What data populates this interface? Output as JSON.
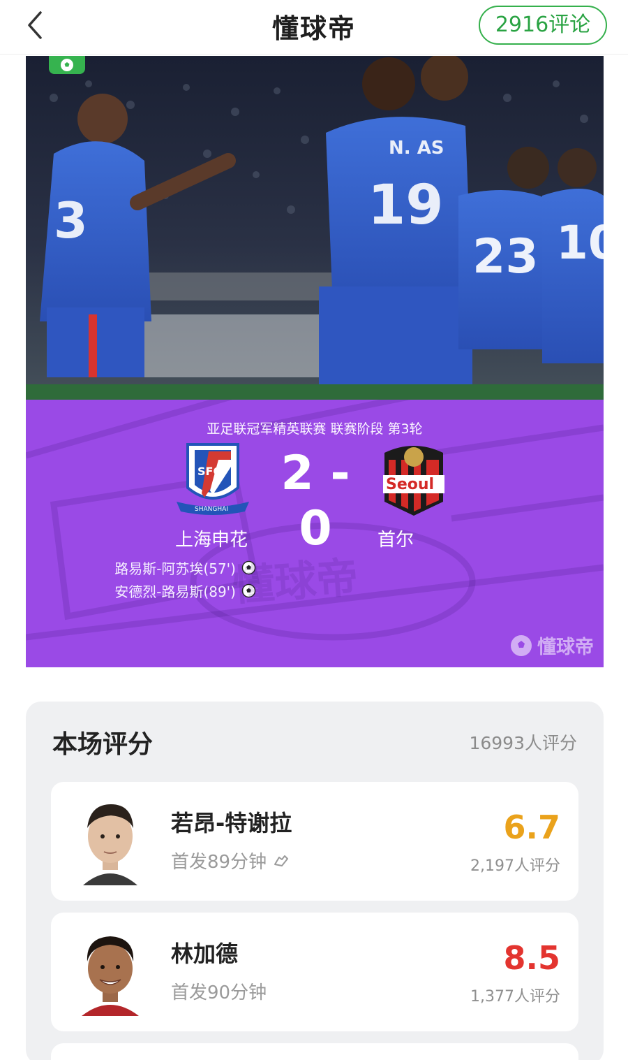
{
  "header": {
    "title": "懂球帝",
    "comments_label": "2916评论"
  },
  "match": {
    "competition": "亚足联冠军精英联赛 联赛阶段 第3轮",
    "score": "2 - 0",
    "home_team": "上海申花",
    "away_team": "首尔",
    "home_logo_text": "SFC",
    "home_logo_ribbon": "SHANGHAI",
    "away_logo_text": "Seoul",
    "scorers": [
      {
        "text": "路易斯-阿苏埃(57')",
        "icon": "soccer-ball-icon"
      },
      {
        "text": "安德烈-路易斯(89')",
        "icon": "soccer-ball-icon"
      }
    ],
    "watermark": "懂球帝",
    "brand_mark": "懂球帝",
    "colors": {
      "panel": "#9a4ae6",
      "accent": "#35b04c"
    }
  },
  "ratings": {
    "title": "本场评分",
    "count": "16993人评分",
    "players": [
      {
        "name": "若昂-特谢拉",
        "info": "首发89分钟",
        "score": "6.7",
        "score_color": "#eaa21b",
        "count": "2,197人评分",
        "icon": "boot-icon"
      },
      {
        "name": "林加德",
        "info": "首发90分钟",
        "score": "8.5",
        "score_color": "#e3342f",
        "count": "1,377人评分"
      }
    ]
  }
}
